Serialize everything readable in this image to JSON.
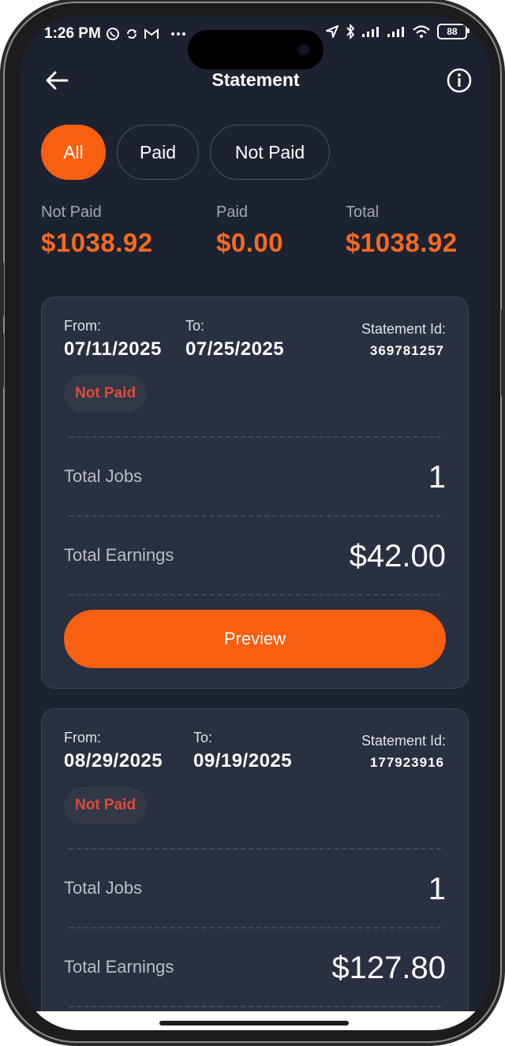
{
  "status_bar": {
    "time": "1:26 PM",
    "battery": "88",
    "icons": [
      "whatsapp-icon",
      "sync-icon",
      "gmail-icon",
      "more-dots-icon",
      "location-arrow-icon",
      "bluetooth-icon",
      "signal-icon",
      "signal-icon",
      "wifi-icon",
      "battery-icon"
    ]
  },
  "header": {
    "title": "Statement",
    "back_icon": "arrow-left-icon",
    "info_icon": "info-icon"
  },
  "filters": [
    {
      "label": "All",
      "active": true
    },
    {
      "label": "Paid",
      "active": false
    },
    {
      "label": "Not Paid",
      "active": false
    }
  ],
  "summary": {
    "not_paid": {
      "label": "Not Paid",
      "value": "$1038.92"
    },
    "paid": {
      "label": "Paid",
      "value": "$0.00"
    },
    "total": {
      "label": "Total",
      "value": "$1038.92"
    }
  },
  "statements": [
    {
      "from_label": "From:",
      "from": "07/11/2025",
      "to_label": "To:",
      "to": "07/25/2025",
      "id_label": "Statement Id:",
      "id": "369781257",
      "status": "Not Paid",
      "jobs_label": "Total Jobs",
      "jobs": "1",
      "earnings_label": "Total Earnings",
      "earnings": "$42.00",
      "button": "Preview"
    },
    {
      "from_label": "From:",
      "from": "08/29/2025",
      "to_label": "To:",
      "to": "09/19/2025",
      "id_label": "Statement Id:",
      "id": "177923916",
      "status": "Not Paid",
      "jobs_label": "Total Jobs",
      "jobs": "1",
      "earnings_label": "Total Earnings",
      "earnings": "$127.80"
    }
  ],
  "colors": {
    "accent": "#f95f10",
    "amount": "#f76a1e",
    "background": "#1c2230",
    "card": "#293040",
    "not_paid_text": "#e24a3b"
  }
}
